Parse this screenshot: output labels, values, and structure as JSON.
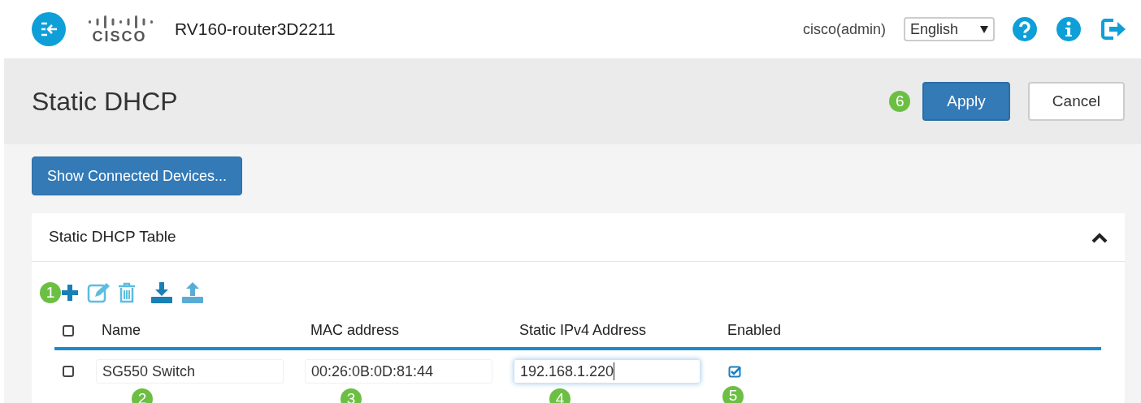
{
  "header": {
    "logo_text": "CISCO",
    "device_name": "RV160-router3D2211",
    "user": "cisco(admin)",
    "language": "English"
  },
  "page": {
    "title": "Static DHCP",
    "buttons": [
      {
        "label": "Apply",
        "kind": "primary",
        "callout": "6"
      },
      {
        "label": "Cancel",
        "kind": "default"
      }
    ]
  },
  "show_devices_button": "Show Connected Devices...",
  "table": {
    "title": "Static DHCP Table",
    "expanded": true,
    "toolbar_callout": "1",
    "select_all_checked": false,
    "columns": [
      "Name",
      "MAC address",
      "Static IPv4 Address",
      "Enabled"
    ],
    "rows": [
      {
        "checked": false,
        "name": {
          "value": "SG550 Switch",
          "callout": "2"
        },
        "mac": {
          "value": "00:26:0B:0D:81:44",
          "callout": "3"
        },
        "ip": {
          "value": "192.168.1.220",
          "callout": "4",
          "focused": true
        },
        "enabled": {
          "checked": true,
          "callout": "5"
        }
      }
    ]
  }
}
